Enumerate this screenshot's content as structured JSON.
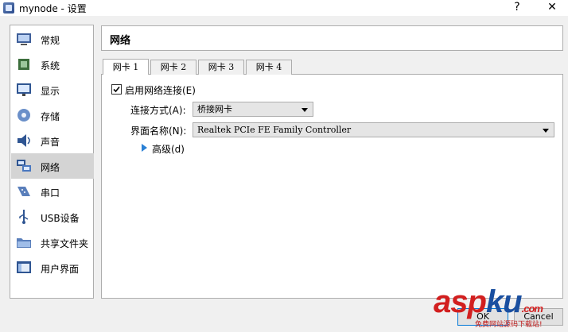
{
  "window": {
    "title": "mynode - 设置",
    "help_label": "?",
    "close_label": "✕"
  },
  "sidebar": {
    "items": [
      {
        "label": "常规",
        "icon": "general-icon"
      },
      {
        "label": "系统",
        "icon": "system-icon"
      },
      {
        "label": "显示",
        "icon": "display-icon"
      },
      {
        "label": "存储",
        "icon": "storage-icon"
      },
      {
        "label": "声音",
        "icon": "audio-icon"
      },
      {
        "label": "网络",
        "icon": "network-icon",
        "selected": true
      },
      {
        "label": "串口",
        "icon": "serial-port-icon"
      },
      {
        "label": "USB设备",
        "icon": "usb-icon"
      },
      {
        "label": "共享文件夹",
        "icon": "shared-folder-icon"
      },
      {
        "label": "用户界面",
        "icon": "user-interface-icon"
      }
    ]
  },
  "main": {
    "title": "网络",
    "tabs": [
      {
        "label": "网卡 1",
        "active": true
      },
      {
        "label": "网卡 2"
      },
      {
        "label": "网卡 3"
      },
      {
        "label": "网卡 4"
      }
    ],
    "enable_label": "启用网络连接(E)",
    "enable_checked": true,
    "attached_label": "连接方式(A):",
    "attached_value": "桥接网卡",
    "name_label": "界面名称(N):",
    "name_value": "Realtek PCIe FE Family Controller",
    "advanced_label": "高级(d)"
  },
  "footer": {
    "ok_label": "OK",
    "cancel_label": "Cancel"
  },
  "watermark": {
    "text_a": "asp",
    "text_b": "ku",
    "text_c": ".com",
    "subtitle": "免费网站源码下载站!"
  },
  "colors": {
    "selected_bg": "#d4d4d4",
    "accent_blue": "#2a80d5",
    "watermark_red": "#d21f1f",
    "watermark_blue": "#1a4fa0"
  }
}
